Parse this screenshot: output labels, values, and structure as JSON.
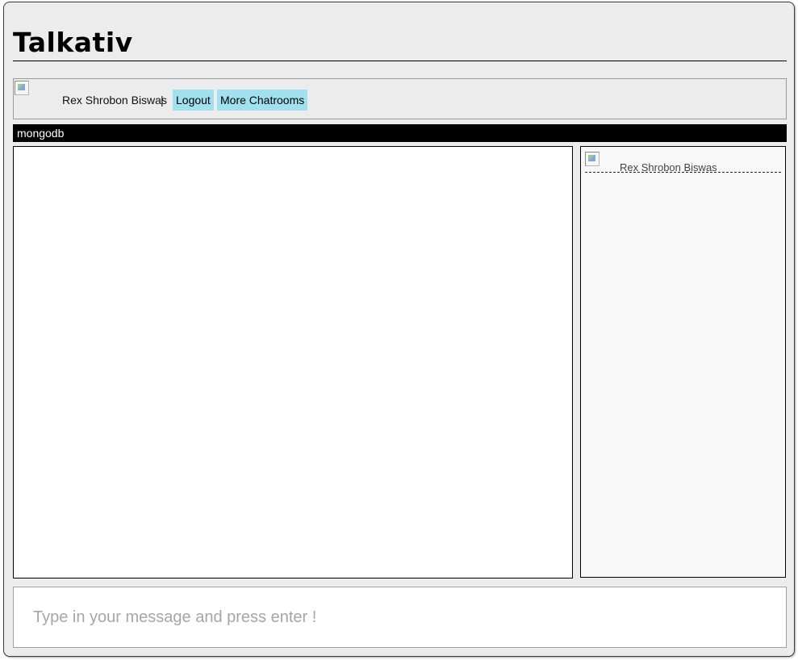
{
  "app": {
    "title": "Talkativ"
  },
  "user_bar": {
    "user_name": "Rex Shrobon Biswas",
    "separator": "|",
    "logout_label": "Logout",
    "more_chatrooms_label": "More Chatrooms",
    "button_color": "#9fe1ee"
  },
  "room": {
    "name": "mongodb",
    "bar_color": "#000000"
  },
  "messages": [],
  "online_users": [
    {
      "name": "Rex Shrobon Biswas"
    }
  ],
  "composer": {
    "value": "",
    "placeholder": "Type in your message and press enter !"
  }
}
